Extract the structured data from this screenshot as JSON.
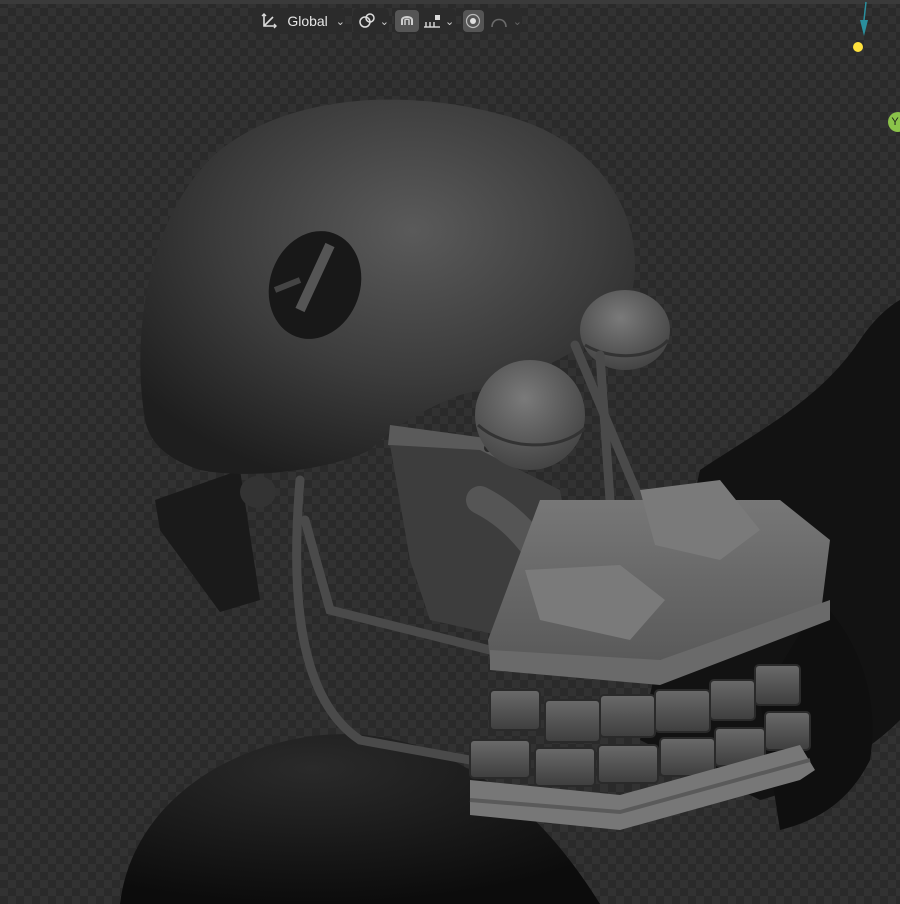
{
  "header": {
    "transform_orientation": {
      "icon": "transform-orientation-icon",
      "label": "Global"
    },
    "pivot": {
      "icon": "pivot-point-icon"
    },
    "snap": {
      "icon": "snap-magnet-icon",
      "options_icon": "snap-increment-icon"
    },
    "proportional": {
      "icon": "proportional-editing-icon",
      "falloff_icon": "falloff-curve-icon"
    }
  },
  "gizmo": {
    "colors": {
      "z_axis": "#2a8f9e",
      "y_axis": "#8bc34a",
      "light": "#ffe23d"
    },
    "y_label": "Y"
  }
}
